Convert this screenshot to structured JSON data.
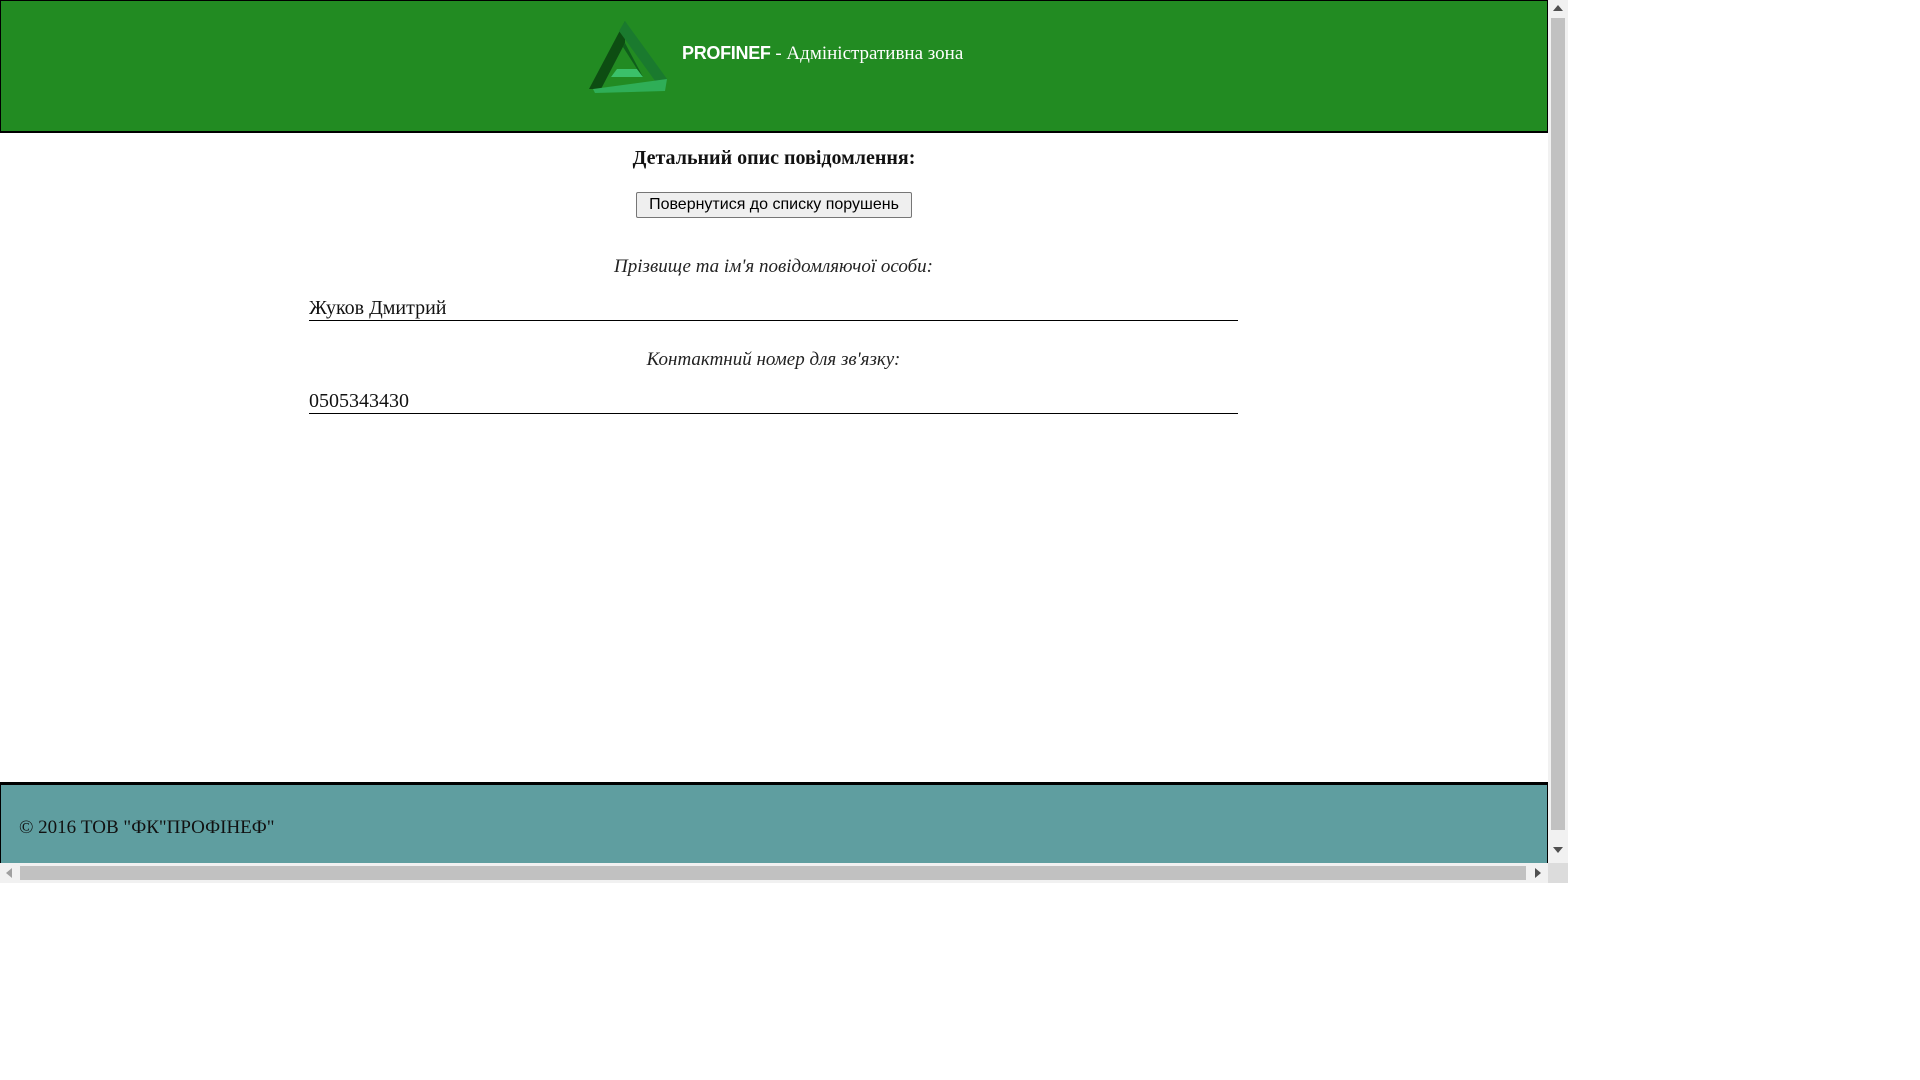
{
  "header": {
    "brand": "PROFINEF",
    "title_suffix": " - Адміністративна зона",
    "logo_icon": "penrose-triangle-logo",
    "background_color": "#228b22"
  },
  "main": {
    "heading": "Детальний опис повідомлення:",
    "back_button_label": "Повернутися до списку порушень",
    "fields": [
      {
        "label": "Прізвище та ім'я повідомляючої особи:",
        "value": "Жуков Дмитрий"
      },
      {
        "label": "Контактний номер для зв'язку:",
        "value": "0505343430"
      }
    ]
  },
  "footer": {
    "copyright": "© 2016 ТОВ \"ФК\"ПРОФІНЕФ\"",
    "background_color": "#5f9ea0"
  }
}
